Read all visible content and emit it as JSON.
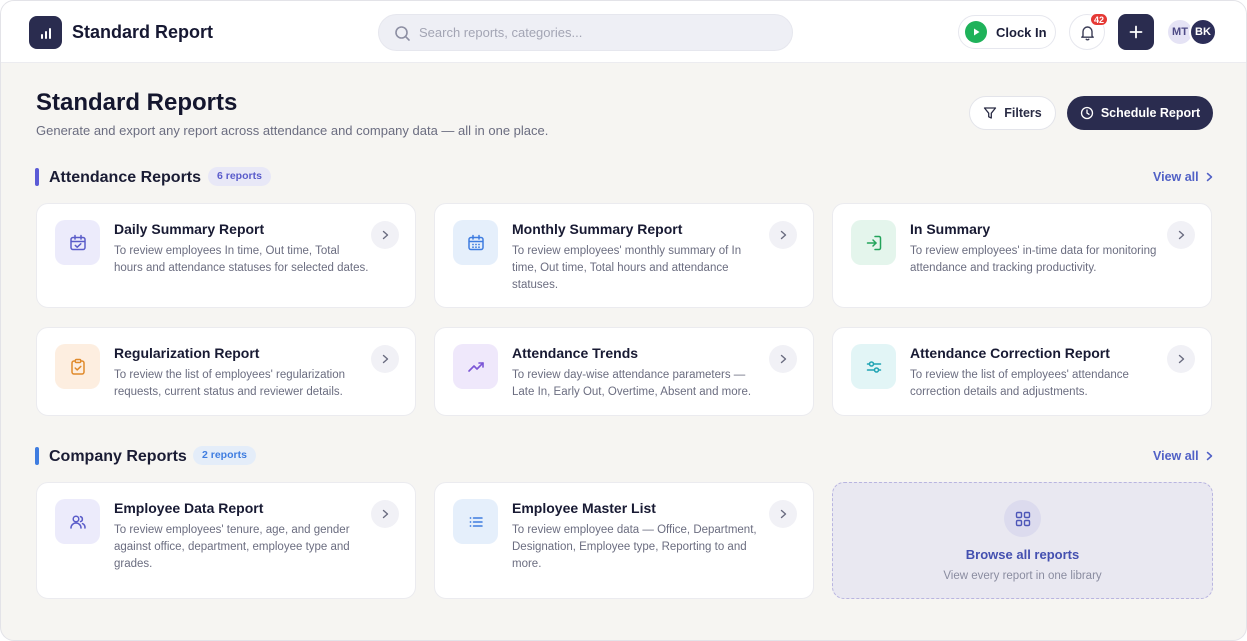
{
  "header": {
    "app_title": "Standard Report",
    "search_placeholder": "Search reports, categories...",
    "clock_in_label": "Clock In",
    "notification_count": "42",
    "avatars": [
      "MT",
      "BK"
    ]
  },
  "page": {
    "title": "Standard Reports",
    "subtitle": "Generate and export any report across attendance and company data — all in one place.",
    "filters_label": "Filters",
    "schedule_label": "Schedule Report"
  },
  "attendance": {
    "title": "Attendance Reports",
    "count": "6 reports",
    "view_all": "View all",
    "accent": "#5b5bd6",
    "cards": [
      {
        "title": "Daily Summary Report",
        "desc": "To review employees In time, Out time, Total hours and attendance statuses for selected dates.",
        "icon": "calendar-check-icon"
      },
      {
        "title": "Monthly Summary Report",
        "desc": "To review employees' monthly summary of In time, Out time, Total hours and attendance statuses.",
        "icon": "calendar-grid-icon"
      },
      {
        "title": "In Summary",
        "desc": "To review employees' in-time data for monitoring attendance and tracking productivity.",
        "icon": "login-icon"
      },
      {
        "title": "Regularization Report",
        "desc": "To review the list of employees' regularization requests, current status and reviewer details.",
        "icon": "clipboard-check-icon"
      },
      {
        "title": "Attendance Trends",
        "desc": "To review day-wise attendance parameters — Late In, Early Out, Overtime, Absent and more.",
        "icon": "trend-up-icon"
      },
      {
        "title": "Attendance Correction Report",
        "desc": "To review the list of employees' attendance correction details and adjustments.",
        "icon": "sliders-icon"
      }
    ]
  },
  "company": {
    "title": "Company Reports",
    "count": "2 reports",
    "view_all": "View all",
    "accent": "#3f7de0",
    "cards": [
      {
        "title": "Employee Data Report",
        "desc": "To review employees' tenure, age, and gender against office, department, employee type and grades.",
        "icon": "users-icon"
      },
      {
        "title": "Employee Master List",
        "desc": "To review employee data — Office, Department, Designation, Employee type, Reporting to and more.",
        "icon": "list-icon"
      }
    ],
    "browse_title": "Browse all reports",
    "browse_sub": "View every report in one library"
  }
}
